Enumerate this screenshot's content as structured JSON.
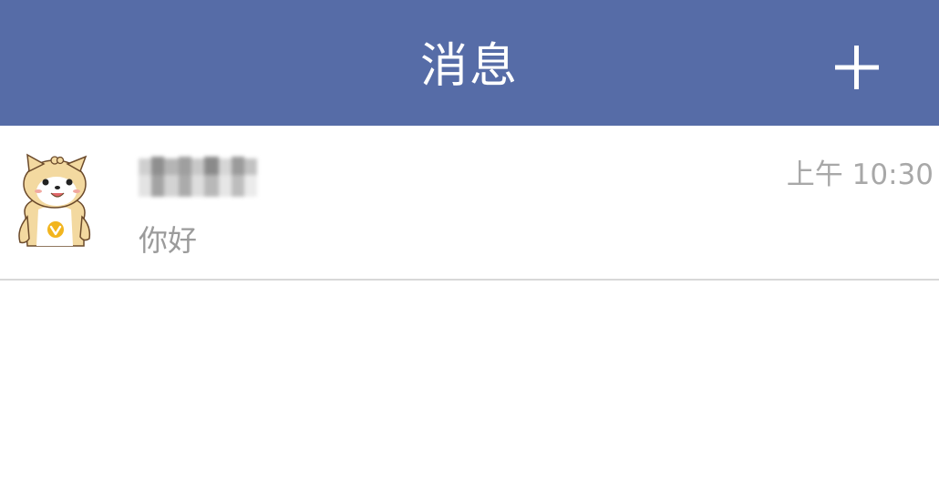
{
  "header": {
    "title": "消息",
    "add_icon": "plus-icon",
    "background": "#566ca7"
  },
  "conversations": [
    {
      "name": "",
      "name_obscured": true,
      "avatar": "cartoon-dog-avatar",
      "preview": "你好",
      "time": "上午 10:30"
    }
  ]
}
